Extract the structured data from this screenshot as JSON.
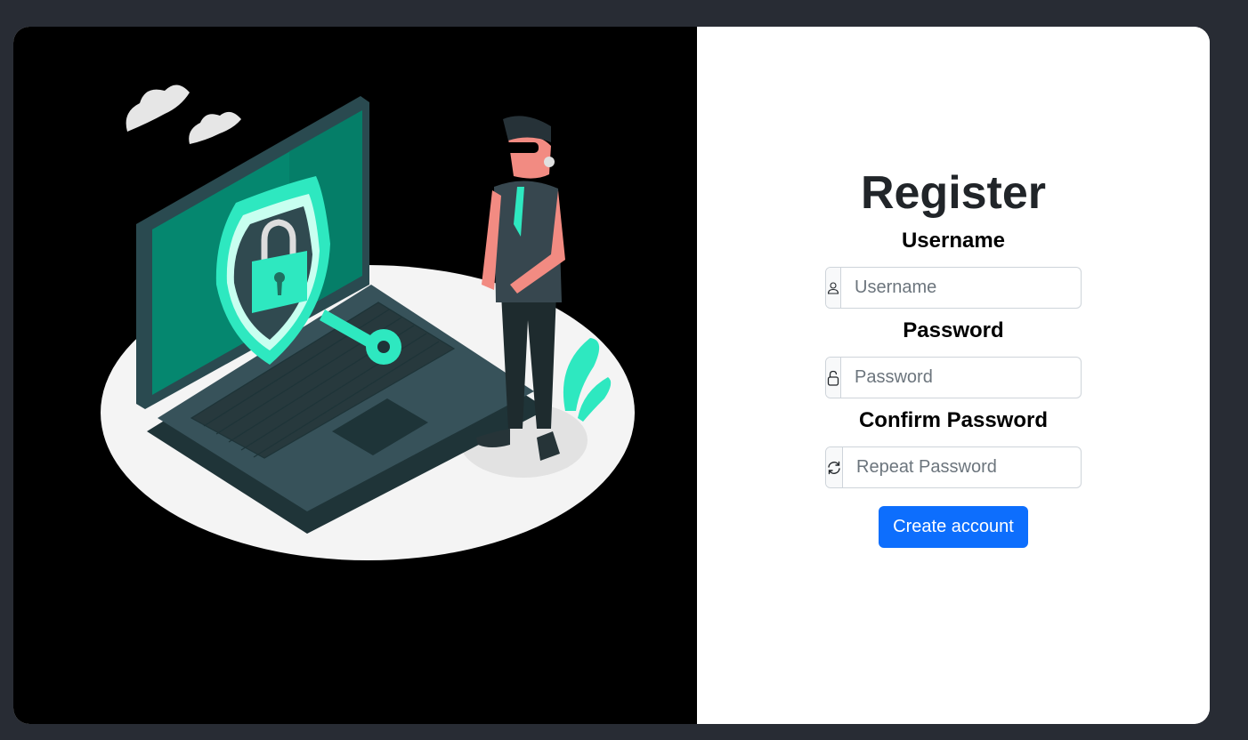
{
  "form": {
    "title": "Register",
    "fields": [
      {
        "label": "Username",
        "placeholder": "Username",
        "icon": "person-icon"
      },
      {
        "label": "Password",
        "placeholder": "Password",
        "icon": "lock-icon"
      },
      {
        "label": "Confirm Password",
        "placeholder": "Repeat Password",
        "icon": "refresh-icon"
      }
    ],
    "submit_label": "Create account"
  },
  "colors": {
    "background": "#282c34",
    "illustration_bg": "#000000",
    "accent": "#0d6efd",
    "teal": "#2ee8c0"
  }
}
